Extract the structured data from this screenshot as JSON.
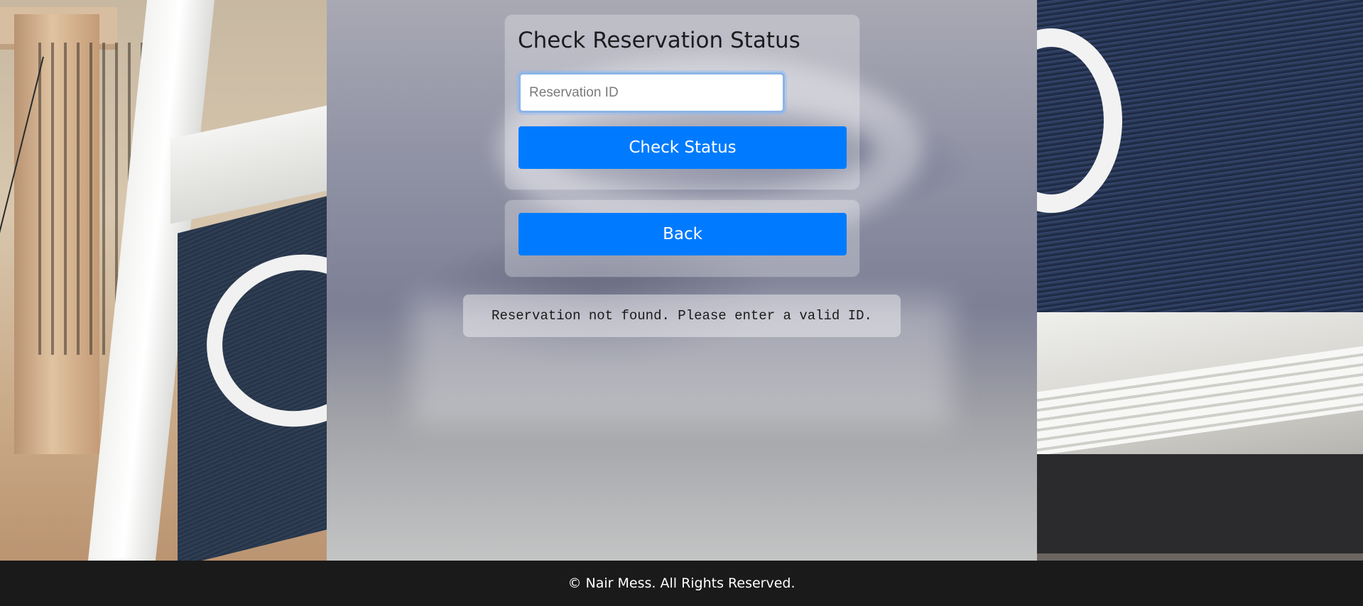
{
  "status_card": {
    "title": "Check Reservation Status",
    "input": {
      "placeholder": "Reservation ID",
      "value": ""
    },
    "check_button_label": "Check Status"
  },
  "back_card": {
    "back_button_label": "Back"
  },
  "message": {
    "text": "Reservation not found. Please enter a valid ID."
  },
  "footer": {
    "text": "© Nair Mess. All Rights Reserved."
  },
  "colors": {
    "button": "#007bff",
    "footer_bg": "#1a1a1a"
  },
  "background": {
    "icon": "storefront-photo"
  }
}
